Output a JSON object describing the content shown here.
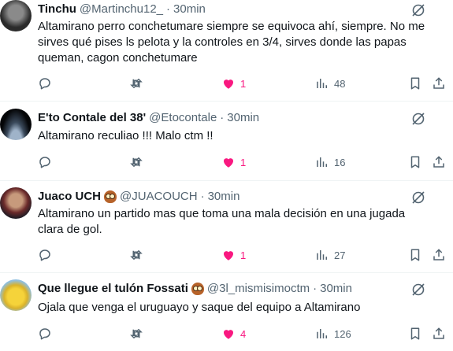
{
  "tweets": [
    {
      "name": "Tinchu",
      "badge": false,
      "handle": "@Martinchu12_",
      "separator": "·",
      "time": "30min",
      "text": "Altamirano perro conchetumare siempre se equivoca ahí, siempre. No me sirves qué pises ls pelota y la controles en 3/4, sirves donde las papas queman, cagon conchetumare",
      "likes": "1",
      "views": "48"
    },
    {
      "name": "E'to Contale del 38'",
      "badge": false,
      "handle": "@Etocontale",
      "separator": "·",
      "time": "30min",
      "text": "Altamirano reculiao !!! Malo ctm !!",
      "likes": "1",
      "views": "16"
    },
    {
      "name": "Juaco UCH",
      "badge": true,
      "handle": "@JUACOUCH",
      "separator": "·",
      "time": "30min",
      "text": "Altamirano un partido mas que toma una mala decisión en una jugada clara de gol.",
      "likes": "1",
      "views": "27"
    },
    {
      "name": "Que llegue el tulón Fossati",
      "badge": true,
      "handle": "@3l_mismisimoctm",
      "separator": "·",
      "time": "30min",
      "text": "Ojala que venga el uruguayo y saque del equipo a Altamirano",
      "likes": "4",
      "views": "126"
    }
  ],
  "icons": {
    "top": "grok-slash-icon",
    "reply": "reply-icon",
    "retweet": "retweet-icon",
    "like": "heart-filled-icon",
    "views": "views-bar-chart-icon",
    "bookmark": "bookmark-icon",
    "share": "share-icon"
  },
  "colors": {
    "text": "#0f1419",
    "secondary": "#536471",
    "like": "#f91880",
    "divider": "#eff3f4"
  }
}
